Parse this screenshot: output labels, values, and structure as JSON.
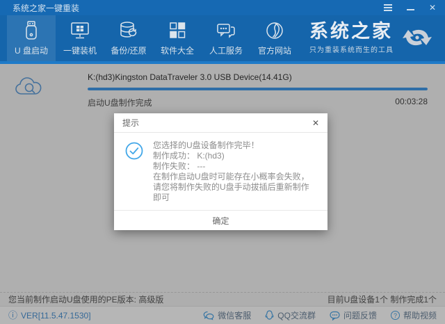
{
  "window": {
    "title": "系统之家一键重装"
  },
  "titlebar": {
    "close_glyph": "✕"
  },
  "nav": {
    "items": [
      {
        "label": "U 盘启动",
        "selected": true,
        "icon": "usb-drive-icon"
      },
      {
        "label": "一键装机",
        "selected": false,
        "icon": "monitor-windows-icon"
      },
      {
        "label": "备份/还原",
        "selected": false,
        "icon": "database-restore-icon"
      },
      {
        "label": "软件大全",
        "selected": false,
        "icon": "apps-grid-icon"
      },
      {
        "label": "人工服务",
        "selected": false,
        "icon": "chat-service-icon"
      },
      {
        "label": "官方网站",
        "selected": false,
        "icon": "globe-icon"
      }
    ],
    "logo": {
      "title": "系统之家",
      "tagline": "只为重装系统而生的工具"
    }
  },
  "progress": {
    "device": "K:(hd3)Kingston DataTraveler 3.0 USB Device(14.41G)",
    "status": "启动U盘制作完成",
    "elapsed": "00:03:28",
    "percent": 100,
    "bar_color": "#3f96e4"
  },
  "dialog": {
    "title": "提示",
    "close_glyph": "✕",
    "line1": "您选择的U盘设备制作完毕！",
    "line2": "制作成功： K:(hd3)",
    "line3": "制作失败： ---",
    "line4": "在制作启动U盘时可能存在小概率会失败，请您将制作失败的U盘手动拔插后重新制作即可",
    "confirm_label": "确定"
  },
  "statusbar": {
    "left": "您当前制作启动U盘使用的PE版本: 高级版",
    "right": "目前U盘设备1个 制作完成1个"
  },
  "footer": {
    "info_glyph": "ⓘ",
    "version": "VER[11.5.47.1530]",
    "links": [
      {
        "label": "微信客服",
        "icon": "wechat-icon"
      },
      {
        "label": "QQ交流群",
        "icon": "qq-icon"
      },
      {
        "label": "问题反馈",
        "icon": "feedback-bubble-icon"
      },
      {
        "label": "帮助视频",
        "icon": "help-icon",
        "glyph": "?"
      }
    ]
  },
  "colors": {
    "titlebar_blue": "#1669b3",
    "nav_blue": "#1565ab",
    "strip_blue": "#1e7ac8",
    "progress_blue": "#3f96e4",
    "check_blue": "#42a7e8"
  }
}
